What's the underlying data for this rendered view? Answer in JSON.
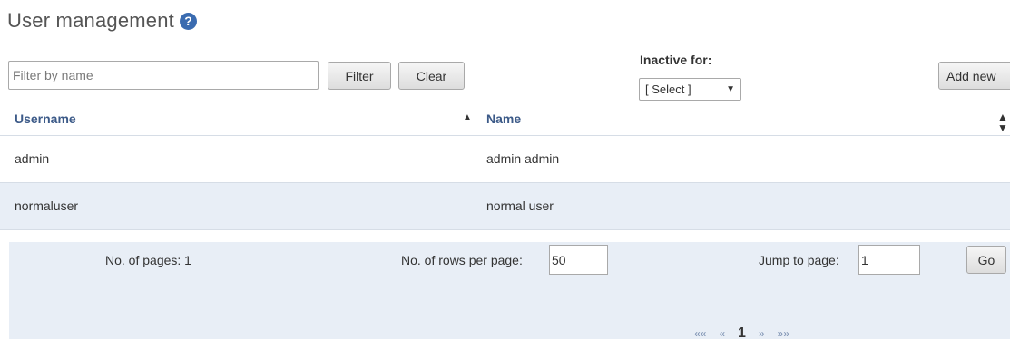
{
  "header": {
    "title": "User management",
    "help_icon": "question-circle-icon",
    "help_glyph": "?"
  },
  "toolbar": {
    "filter_placeholder": "Filter by name",
    "filter_value": "",
    "filter_label": "Filter",
    "clear_label": "Clear",
    "inactive_label": "Inactive for:",
    "inactive_selected": "[ Select ]",
    "add_new_label": "Add new"
  },
  "table": {
    "columns": [
      {
        "label": "Username",
        "sort": "ascending"
      },
      {
        "label": "Name",
        "sort": "sortable"
      }
    ],
    "rows": [
      {
        "username": "admin",
        "name": "admin admin"
      },
      {
        "username": "normaluser",
        "name": "normal user"
      }
    ]
  },
  "pager": {
    "pages_label": "No. of pages: 1",
    "rows_per_page_label": "No. of rows per page:",
    "rows_per_page_value": "50",
    "jump_label": "Jump to page:",
    "jump_value": "1",
    "go_label": "Go",
    "nav": {
      "first": "««",
      "prev": "«",
      "current": "1",
      "next": "»",
      "last": "»»"
    }
  },
  "colors": {
    "header_text": "#3c5a88",
    "alt_row": "#e8eef6",
    "help_icon_bg": "#3a6bb0"
  }
}
